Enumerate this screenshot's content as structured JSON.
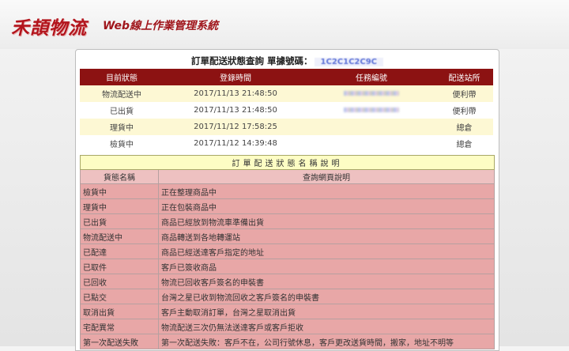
{
  "header": {
    "logo": "禾頡物流",
    "system_title": "Web線上作業管理系統"
  },
  "query": {
    "title": "訂單配送狀態查詢  單據號碼：",
    "order_no": "1C2C1C2C9C"
  },
  "status_table": {
    "columns": [
      "目前狀態",
      "登錄時間",
      "任務編號",
      "配送站所"
    ],
    "rows": [
      {
        "status": "物流配送中",
        "time": "2017/11/13 21:48:50",
        "task": "",
        "station": "便利帶"
      },
      {
        "status": "已出貨",
        "time": "2017/11/13 21:48:50",
        "task": "",
        "station": "便利帶"
      },
      {
        "status": "理貨中",
        "time": "2017/11/12 17:58:25",
        "task": "",
        "station": "總倉"
      },
      {
        "status": "檢貨中",
        "time": "2017/11/12 14:39:48",
        "task": "",
        "station": "總倉"
      }
    ]
  },
  "legend": {
    "caption": "訂單配送狀態名稱說明",
    "columns": [
      "貨態名稱",
      "查詢網頁說明"
    ],
    "rows": [
      {
        "name": "檢貨中",
        "desc": "正在整理商品中"
      },
      {
        "name": "理貨中",
        "desc": "正在包裝商品中"
      },
      {
        "name": "已出貨",
        "desc": "商品已經放到物流車準備出貨"
      },
      {
        "name": "物流配送中",
        "desc": "商品轉送到各地轉運站"
      },
      {
        "name": "已配達",
        "desc": "商品已經送達客戶指定的地址"
      },
      {
        "name": "已取件",
        "desc": "客戶已簽收商品"
      },
      {
        "name": "已回收",
        "desc": "物流已回收客戶簽名的申裝書"
      },
      {
        "name": "已點交",
        "desc": "台灣之星已收到物流回收之客戶簽名的申裝書"
      },
      {
        "name": "取消出貨",
        "desc": "客戶主動取消訂單，台灣之星取消出貨"
      },
      {
        "name": "宅配異常",
        "desc": "物流配送三次仍無法送達客戶或客戶拒收"
      },
      {
        "name": "第一次配送失敗",
        "desc": "第一次配送失敗：客戶不在，公司行號休息，客戶更改送貨時間，搬家，地址不明等"
      }
    ]
  }
}
